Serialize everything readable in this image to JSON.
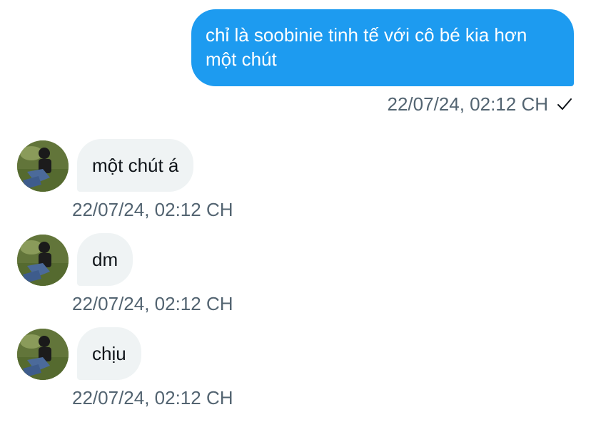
{
  "sent": {
    "text": "chỉ là soobinie tinh tế với cô bé kia hơn một chút",
    "timestamp": "22/07/24, 02:12 CH",
    "status_icon": "check-icon"
  },
  "received": [
    {
      "text": "một chút á",
      "timestamp": "22/07/24, 02:12 CH"
    },
    {
      "text": "dm",
      "timestamp": "22/07/24, 02:12 CH"
    },
    {
      "text": "chịu",
      "timestamp": "22/07/24, 02:12 CH"
    }
  ],
  "colors": {
    "sent_bubble": "#1d9bf0",
    "received_bubble": "#eff3f4",
    "meta_text": "#536471",
    "message_text": "#0f1419"
  }
}
